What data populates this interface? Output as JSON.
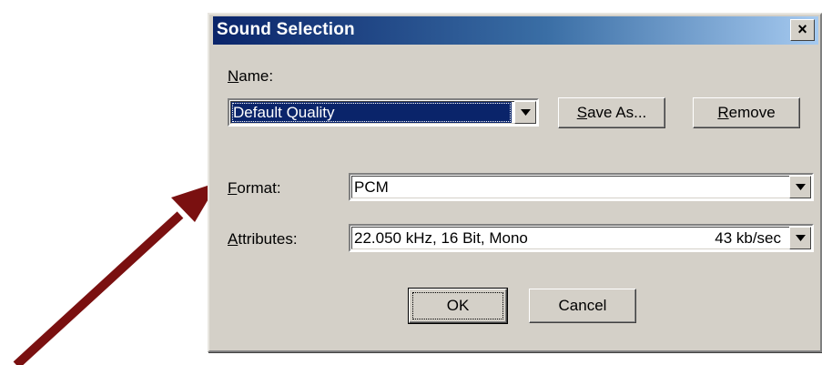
{
  "dialog": {
    "title": "Sound Selection",
    "close_symbol": "×"
  },
  "name": {
    "label_mnemonic": "N",
    "label_rest": "ame:",
    "value": "Default Quality"
  },
  "buttons": {
    "save_as_mnemonic": "S",
    "save_as_rest": "ave As...",
    "remove_mnemonic": "R",
    "remove_rest": "emove",
    "ok": "OK",
    "cancel": "Cancel"
  },
  "format": {
    "label_mnemonic": "F",
    "label_rest": "ormat:",
    "value": "PCM"
  },
  "attributes": {
    "label_mnemonic": "A",
    "label_rest": "ttributes:",
    "value": "22.050 kHz, 16 Bit, Mono",
    "rate": "43 kb/sec"
  },
  "icons": {
    "arrow": "red-arrow-icon",
    "dropdown": "triangle-down-icon",
    "close": "close-icon"
  },
  "colors": {
    "arrow": "#7a1010",
    "titlebar_start": "#0a246a",
    "titlebar_end": "#a6caf0",
    "dialog_bg": "#d4d0c8",
    "selection": "#0a246a"
  }
}
